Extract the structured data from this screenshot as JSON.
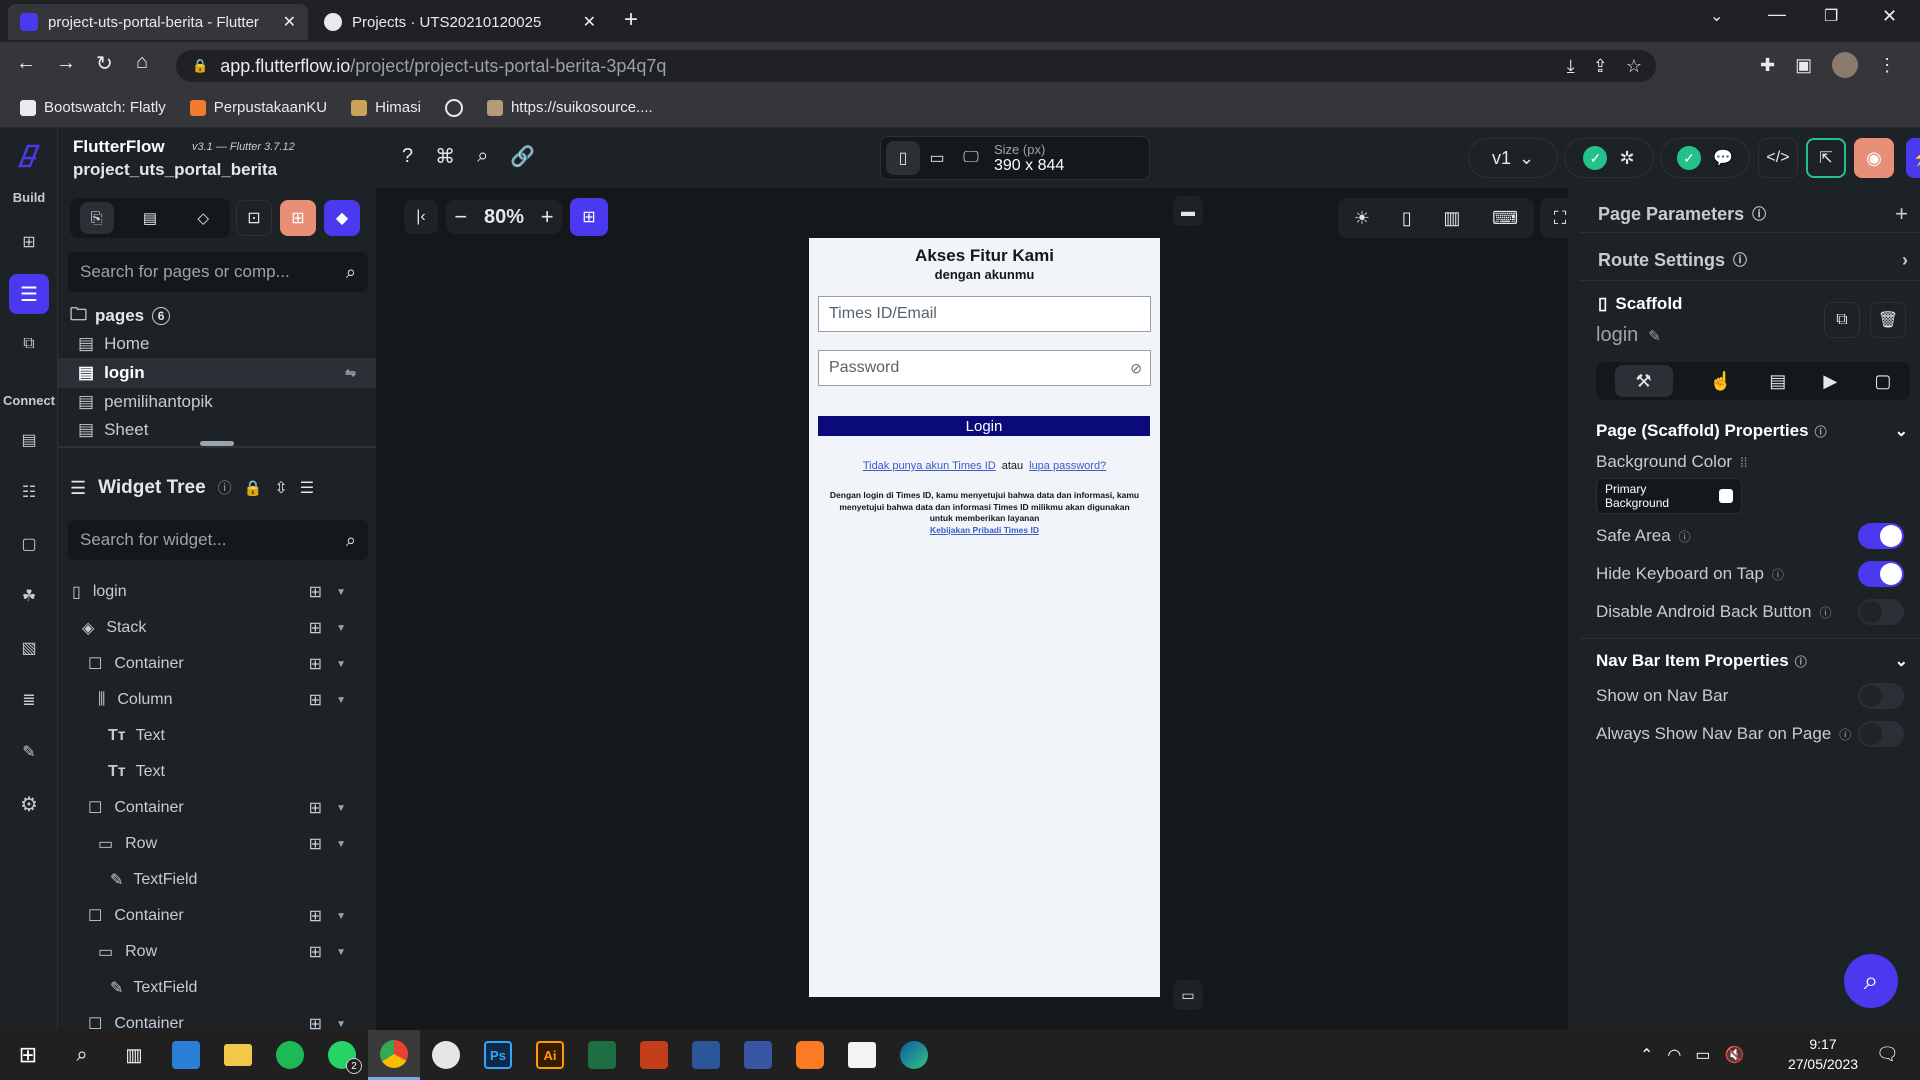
{
  "browser": {
    "tabs": [
      {
        "title": "project-uts-portal-berita - Flutter"
      },
      {
        "title": "Projects · UTS20210120025"
      }
    ],
    "url_host": "app.flutterflow.io",
    "url_path": "/project/project-uts-portal-berita-3p4q7q",
    "bookmarks": [
      "Bootswatch: Flatly",
      "PerpustakaanKU",
      "Himasi",
      "https://suikosource...."
    ]
  },
  "header": {
    "app_name": "FlutterFlow",
    "version": "v3.1 — Flutter 3.7.12",
    "project_name": "project_uts_portal_berita",
    "size_label": "Size (px)",
    "size_value": "390 x 844",
    "branch": "v1"
  },
  "rail": {
    "build_label": "Build",
    "connect_label": "Connect"
  },
  "leftpanel": {
    "search_pages_placeholder": "Search for pages or comp...",
    "pages_label": "pages",
    "pages_count": "6",
    "pages": [
      "Home",
      "login",
      "pemilihantopik",
      "Sheet"
    ],
    "widget_tree_title": "Widget Tree",
    "search_widget_placeholder": "Search for widget...",
    "tree": [
      {
        "label": "login"
      },
      {
        "label": "Stack"
      },
      {
        "label": "Container"
      },
      {
        "label": "Column"
      },
      {
        "label": "Text"
      },
      {
        "label": "Text"
      },
      {
        "label": "Container"
      },
      {
        "label": "Row"
      },
      {
        "label": "TextField"
      },
      {
        "label": "Container"
      },
      {
        "label": "Row"
      },
      {
        "label": "TextField"
      },
      {
        "label": "Container"
      }
    ]
  },
  "canvas": {
    "zoom": "80%"
  },
  "phone": {
    "title": "Akses Fitur Kami",
    "subtitle": "dengan akunmu",
    "email_placeholder": "Times ID/Email",
    "password_placeholder": "Password",
    "login_button": "Login",
    "no_account_link": "Tidak punya akun Times ID",
    "or_text": "atau",
    "forgot_link": "lupa password?",
    "terms_text": "Dengan login di Times ID, kamu menyetujui bahwa data dan informasi, kamu menyetujui bahwa data dan informasi Times ID milikmu akan digunakan untuk memberikan layanan",
    "privacy_link": "Kebijakan Pribadi Times ID"
  },
  "rightpanel": {
    "page_parameters": "Page Parameters",
    "route_settings": "Route Settings",
    "scaffold_label": "Scaffold",
    "page_name": "login",
    "section_title": "Page (Scaffold) Properties",
    "background_color_label": "Background Color",
    "background_value": "Primary Background",
    "safe_area": "Safe Area",
    "hide_keyboard": "Hide Keyboard on Tap",
    "disable_back": "Disable Android Back Button",
    "navbar_title": "Nav Bar Item Properties",
    "show_navbar": "Show on Nav Bar",
    "always_show_navbar": "Always Show Nav Bar on Page",
    "toggles": {
      "safe_area": true,
      "hide_keyboard": true,
      "disable_back": false,
      "show_navbar": false,
      "always_show_navbar": false
    }
  },
  "taskbar": {
    "time": "9:17",
    "date": "27/05/2023",
    "whatsapp_badge": "2"
  },
  "colors": {
    "accent": "#4b39ef",
    "login_button": "#0b0a7a",
    "success": "#24c28a",
    "panel": "#1d2226"
  }
}
